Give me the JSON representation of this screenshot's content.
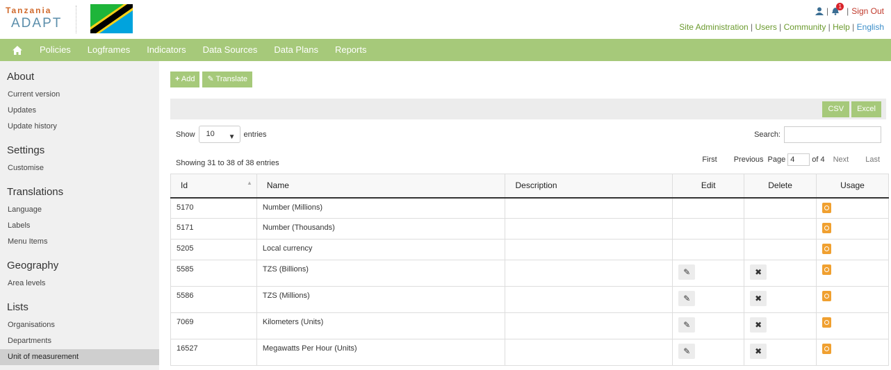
{
  "brand": {
    "line1": "Tanzania",
    "line2": "ADAPT"
  },
  "colors": {
    "accent": "#a6c97a",
    "link": "#6b9a2e",
    "signout": "#c0392b",
    "usage": "#f0a030"
  },
  "top_right": {
    "notification_count": "1",
    "separator": "|",
    "sign_out": "Sign Out",
    "links": [
      "Site Administration",
      "Users",
      "Community",
      "Help",
      "English"
    ]
  },
  "nav": {
    "items": [
      "Policies",
      "Logframes",
      "Indicators",
      "Data Sources",
      "Data Plans",
      "Reports"
    ]
  },
  "sidebar": {
    "sections": [
      {
        "title": "About",
        "items": [
          "Current version",
          "Updates",
          "Update history"
        ]
      },
      {
        "title": "Settings",
        "items": [
          "Customise"
        ]
      },
      {
        "title": "Translations",
        "items": [
          "Language",
          "Labels",
          "Menu Items"
        ]
      },
      {
        "title": "Geography",
        "items": [
          "Area levels"
        ]
      },
      {
        "title": "Lists",
        "items": [
          "Organisations",
          "Departments",
          "Unit of measurement"
        ]
      }
    ],
    "active": "Unit of measurement"
  },
  "toolbar": {
    "add_label": "Add",
    "translate_label": "Translate"
  },
  "export": {
    "csv": "CSV",
    "excel": "Excel"
  },
  "length": {
    "show": "Show",
    "value": "10",
    "entries": "entries"
  },
  "search": {
    "label": "Search:",
    "value": ""
  },
  "info": "Showing 31 to 38 of 38 entries",
  "pager": {
    "first": "First",
    "previous": "Previous",
    "page_label": "Page",
    "page": "4",
    "of": "of 4",
    "next": "Next",
    "last": "Last"
  },
  "table": {
    "columns": [
      "Id",
      "Name",
      "Description",
      "Edit",
      "Delete",
      "Usage"
    ],
    "rows": [
      {
        "id": "5170",
        "name": "Number (Millions)",
        "description": "",
        "editable": false
      },
      {
        "id": "5171",
        "name": "Number (Thousands)",
        "description": "",
        "editable": false
      },
      {
        "id": "5205",
        "name": "Local currency",
        "description": "",
        "editable": false
      },
      {
        "id": "5585",
        "name": "TZS (Billions)",
        "description": "",
        "editable": true
      },
      {
        "id": "5586",
        "name": "TZS (Millions)",
        "description": "",
        "editable": true
      },
      {
        "id": "7069",
        "name": "Kilometers (Units)",
        "description": "",
        "editable": true
      },
      {
        "id": "16527",
        "name": "Megawatts Per Hour (Units)",
        "description": "",
        "editable": true
      }
    ]
  }
}
